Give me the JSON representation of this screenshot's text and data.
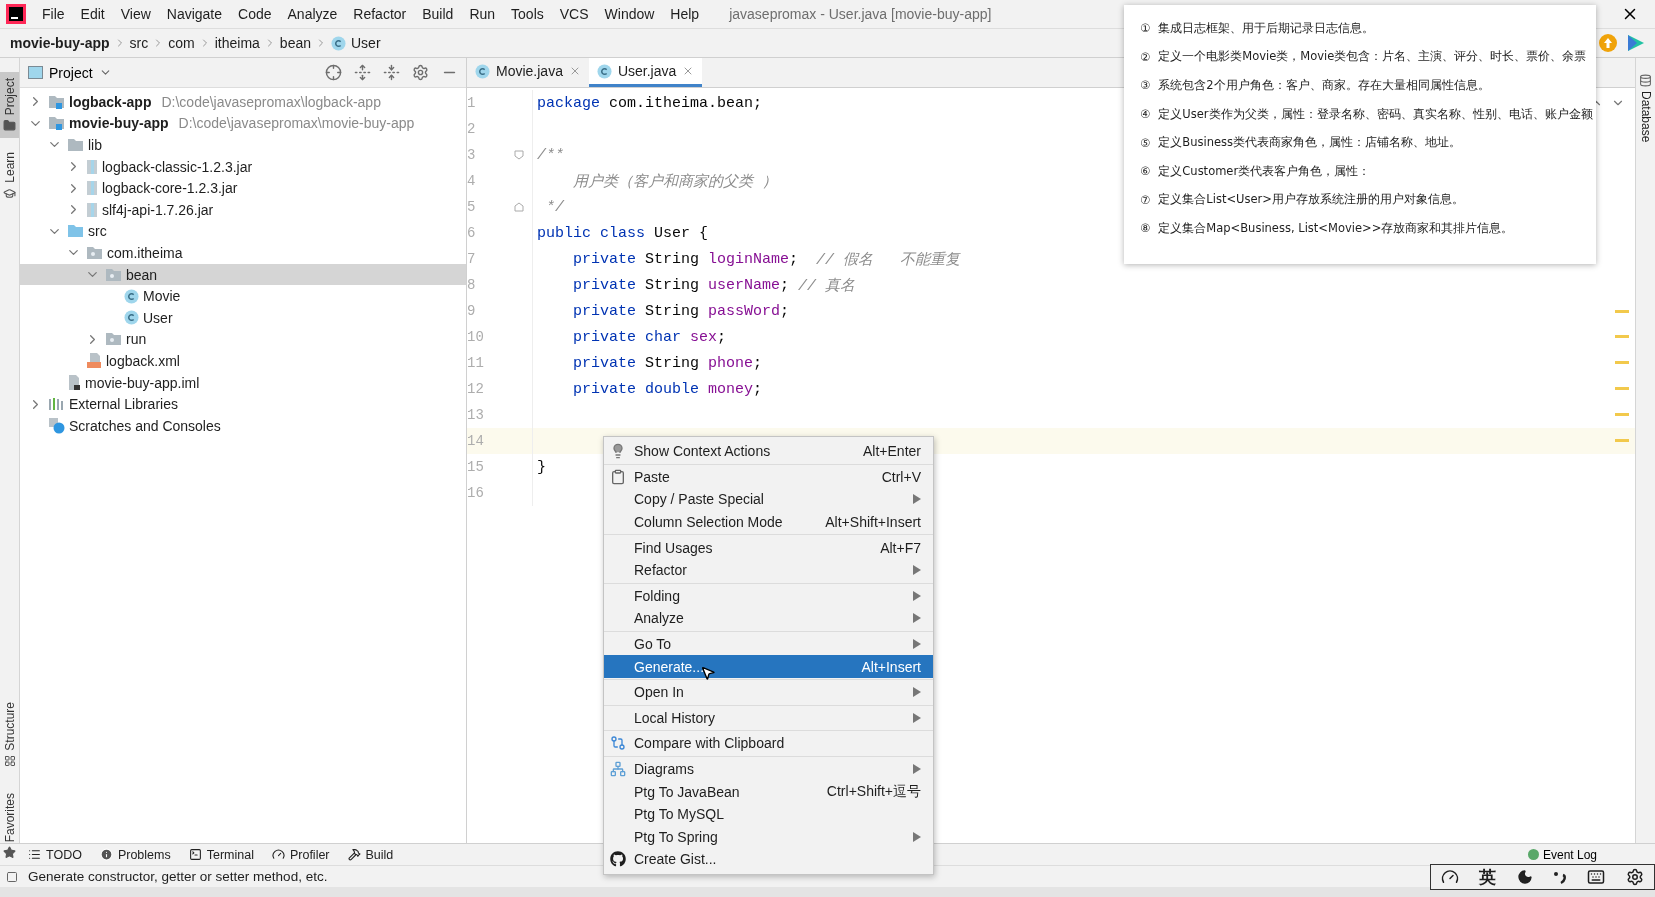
{
  "menu_bar": {
    "items": [
      "File",
      "Edit",
      "View",
      "Navigate",
      "Code",
      "Analyze",
      "Refactor",
      "Build",
      "Run",
      "Tools",
      "VCS",
      "Window",
      "Help"
    ],
    "title": "javasepromax - User.java [movie-buy-app]"
  },
  "breadcrumbs": [
    "movie-buy-app",
    "src",
    "com",
    "itheima",
    "bean",
    "User"
  ],
  "left_strip": [
    {
      "label": "Project",
      "selected": true
    },
    {
      "label": "Learn",
      "selected": false
    },
    {
      "label": "Structure",
      "selected": false
    },
    {
      "label": "Favorites",
      "selected": false
    }
  ],
  "project_panel": {
    "title": "Project",
    "tree": [
      {
        "label": "logback-app",
        "path": "D:\\code\\javasepromax\\logback-app",
        "bold": true,
        "kind": "module",
        "expanded": false,
        "selected": false
      },
      {
        "label": "movie-buy-app",
        "path": "D:\\code\\javasepromax\\movie-buy-app",
        "bold": true,
        "kind": "module",
        "expanded": true,
        "selected": false,
        "children": [
          {
            "label": "lib",
            "kind": "folder",
            "expanded": true,
            "selected": false,
            "children": [
              {
                "label": "logback-classic-1.2.3.jar",
                "kind": "jar",
                "expanded": false,
                "selected": false
              },
              {
                "label": "logback-core-1.2.3.jar",
                "kind": "jar",
                "expanded": false,
                "selected": false
              },
              {
                "label": "slf4j-api-1.7.26.jar",
                "kind": "jar",
                "expanded": false,
                "selected": false
              }
            ]
          },
          {
            "label": "src",
            "kind": "source",
            "expanded": true,
            "selected": false,
            "children": [
              {
                "label": "com.itheima",
                "kind": "package",
                "expanded": true,
                "selected": false,
                "children": [
                  {
                    "label": "bean",
                    "kind": "package",
                    "expanded": true,
                    "selected": true,
                    "children": [
                      {
                        "label": "Movie",
                        "kind": "class",
                        "selected": false
                      },
                      {
                        "label": "User",
                        "kind": "class",
                        "selected": false
                      }
                    ]
                  },
                  {
                    "label": "run",
                    "kind": "package",
                    "expanded": false,
                    "selected": false
                  }
                ]
              },
              {
                "label": "logback.xml",
                "kind": "xml",
                "selected": false
              }
            ]
          },
          {
            "label": "movie-buy-app.iml",
            "kind": "iml",
            "selected": false
          }
        ]
      },
      {
        "label": "External Libraries",
        "kind": "libraries",
        "expanded": false,
        "selected": false
      },
      {
        "label": "Scratches and Consoles",
        "kind": "scratches",
        "selected": false
      }
    ]
  },
  "editor_tabs": [
    {
      "label": "Movie.java",
      "selected": false
    },
    {
      "label": "User.java",
      "selected": true
    }
  ],
  "code_lines": [
    {
      "number": "1",
      "kind": "plain",
      "current": false,
      "tokens": [
        {
          "kind": "keyword",
          "text": "package"
        },
        {
          "kind": "plain",
          "text": " com.itheima.bean;"
        }
      ]
    },
    {
      "number": "2",
      "kind": "plain",
      "current": false
    },
    {
      "number": "3",
      "kind": "fold-start",
      "current": false,
      "tokens": [
        {
          "kind": "comment",
          "text": "/**"
        }
      ]
    },
    {
      "number": "4",
      "kind": "plain",
      "current": false,
      "tokens": [
        {
          "kind": "comment",
          "text": "    用户类（客户和商家的父类 ）"
        }
      ]
    },
    {
      "number": "5",
      "kind": "fold-end",
      "current": false,
      "tokens": [
        {
          "kind": "comment",
          "text": " */"
        }
      ]
    },
    {
      "number": "6",
      "kind": "plain",
      "current": false,
      "tokens": [
        {
          "kind": "keyword",
          "text": "public class"
        },
        {
          "kind": "plain",
          "text": " User {"
        }
      ]
    },
    {
      "number": "7",
      "kind": "plain",
      "current": false,
      "tokens": [
        {
          "kind": "keyword",
          "text": "    private"
        },
        {
          "kind": "plain",
          "text": " String "
        },
        {
          "kind": "field",
          "text": "loginName"
        },
        {
          "kind": "plain",
          "text": ";  "
        },
        {
          "kind": "comment",
          "text": "// 假名   不能重复"
        }
      ]
    },
    {
      "number": "8",
      "kind": "plain",
      "current": false,
      "tokens": [
        {
          "kind": "keyword",
          "text": "    private"
        },
        {
          "kind": "plain",
          "text": " String "
        },
        {
          "kind": "field",
          "text": "userName"
        },
        {
          "kind": "plain",
          "text": "; "
        },
        {
          "kind": "comment",
          "text": "// 真名"
        }
      ]
    },
    {
      "number": "9",
      "kind": "plain",
      "current": false,
      "tokens": [
        {
          "kind": "keyword",
          "text": "    private"
        },
        {
          "kind": "plain",
          "text": " String "
        },
        {
          "kind": "field",
          "text": "passWord"
        },
        {
          "kind": "plain",
          "text": ";"
        }
      ]
    },
    {
      "number": "10",
      "kind": "plain",
      "current": false,
      "tokens": [
        {
          "kind": "keyword",
          "text": "    private char "
        },
        {
          "kind": "field",
          "text": "sex"
        },
        {
          "kind": "plain",
          "text": ";"
        }
      ]
    },
    {
      "number": "11",
      "kind": "plain",
      "current": false,
      "tokens": [
        {
          "kind": "keyword",
          "text": "    private"
        },
        {
          "kind": "plain",
          "text": " String "
        },
        {
          "kind": "field",
          "text": "phone"
        },
        {
          "kind": "plain",
          "text": ";"
        }
      ]
    },
    {
      "number": "12",
      "kind": "plain",
      "current": false,
      "tokens": [
        {
          "kind": "keyword",
          "text": "    private double "
        },
        {
          "kind": "field",
          "text": "money"
        },
        {
          "kind": "plain",
          "text": ";"
        }
      ]
    },
    {
      "number": "13",
      "kind": "plain",
      "current": false
    },
    {
      "number": "14",
      "kind": "plain",
      "current": true
    },
    {
      "number": "15",
      "kind": "plain",
      "current": false,
      "tokens": [
        {
          "kind": "plain",
          "text": "}"
        }
      ]
    },
    {
      "number": "16",
      "kind": "plain",
      "current": false
    }
  ],
  "notes": [
    {
      "marker": "①",
      "text": "集成日志框架、用于后期记录日志信息。"
    },
    {
      "marker": "②",
      "text": "定义一个电影类Movie类，Movie类包含：片名、主演、评分、时长、票价、余票"
    },
    {
      "marker": "③",
      "text": "系统包含2个用户角色：客户、商家。存在大量相同属性信息。"
    },
    {
      "marker": "④",
      "text": "定义User类作为父类，属性：登录名称、密码、真实名称、性别、电话、账户金额"
    },
    {
      "marker": "⑤",
      "text": "定义Business类代表商家角色，属性：店铺名称、地址。"
    },
    {
      "marker": "⑥",
      "text": "定义Customer类代表客户角色，属性："
    },
    {
      "marker": "⑦",
      "text": "定义集合List<User>用户存放系统注册的用户对象信息。"
    },
    {
      "marker": "⑧",
      "text": "定义集合Map<Business, List<Movie>>存放商家和其排片信息。"
    }
  ],
  "context_menu": [
    [
      {
        "label": "Show Context Actions",
        "shortcut": "Alt+Enter",
        "kind": "bulb",
        "submenu": false,
        "selected": false
      }
    ],
    [
      {
        "label": "Paste",
        "shortcut": "Ctrl+V",
        "kind": "clipboard",
        "submenu": false,
        "selected": false
      },
      {
        "label": "Copy / Paste Special",
        "kind": "plain",
        "submenu": true,
        "selected": false
      },
      {
        "label": "Column Selection Mode",
        "shortcut": "Alt+Shift+Insert",
        "kind": "plain",
        "submenu": false,
        "selected": false
      }
    ],
    [
      {
        "label": "Find Usages",
        "shortcut": "Alt+F7",
        "kind": "plain",
        "submenu": false,
        "selected": false
      },
      {
        "label": "Refactor",
        "kind": "plain",
        "submenu": true,
        "selected": false
      }
    ],
    [
      {
        "label": "Folding",
        "kind": "plain",
        "submenu": true,
        "selected": false
      },
      {
        "label": "Analyze",
        "kind": "plain",
        "submenu": true,
        "selected": false
      }
    ],
    [
      {
        "label": "Go To",
        "kind": "plain",
        "submenu": true,
        "selected": false
      },
      {
        "label": "Generate...",
        "shortcut": "Alt+Insert",
        "kind": "plain",
        "submenu": false,
        "selected": true
      }
    ],
    [
      {
        "label": "Open In",
        "kind": "plain",
        "submenu": true,
        "selected": false
      }
    ],
    [
      {
        "label": "Local History",
        "kind": "plain",
        "submenu": true,
        "selected": false
      }
    ],
    [
      {
        "label": "Compare with Clipboard",
        "kind": "compare",
        "submenu": false,
        "selected": false
      }
    ],
    [
      {
        "label": "Diagrams",
        "kind": "diagram",
        "submenu": true,
        "selected": false
      },
      {
        "label": "Ptg To JavaBean",
        "shortcut": "Ctrl+Shift+逗号",
        "kind": "plain",
        "submenu": false,
        "selected": false
      },
      {
        "label": "Ptg To MySQL",
        "kind": "plain",
        "submenu": false,
        "selected": false
      },
      {
        "label": "Ptg To Spring",
        "kind": "plain",
        "submenu": true,
        "selected": false
      },
      {
        "label": "Create Gist...",
        "kind": "github",
        "submenu": false,
        "selected": false
      }
    ]
  ],
  "right_strip": [
    "Database"
  ],
  "tool_buttons": [
    "TODO",
    "Problems",
    "Terminal",
    "Profiler",
    "Build"
  ],
  "event_log": "Event Log",
  "status_bar": "Generate constructor, getter or setter method, etc.",
  "ime_bar": {
    "label": "英"
  }
}
